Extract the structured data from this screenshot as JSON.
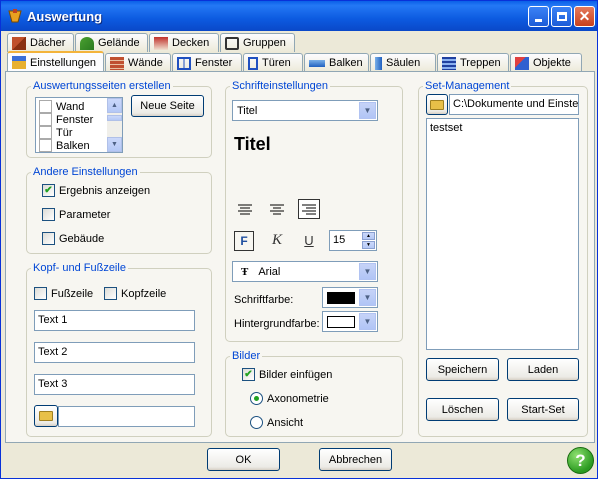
{
  "window": {
    "title": "Auswertung"
  },
  "tabs_row1": [
    "Dächer",
    "Gelände",
    "Decken",
    "Gruppen"
  ],
  "tabs_row2": [
    "Einstellungen",
    "Wände",
    "Fenster",
    "Türen",
    "Balken",
    "Säulen",
    "Treppen",
    "Objekte"
  ],
  "auswertungsseiten": {
    "legend": "Auswertungsseiten erstellen",
    "items": [
      "Wand",
      "Fenster",
      "Tür",
      "Balken"
    ],
    "new_page_button": "Neue Seite"
  },
  "andere": {
    "legend": "Andere Einstellungen",
    "ergebnis": "Ergebnis anzeigen",
    "parameter": "Parameter",
    "gebaeude": "Gebäude"
  },
  "kopf": {
    "legend": "Kopf- und Fußzeile",
    "fusszeile": "Fußzeile",
    "kopfzeile": "Kopfzeile",
    "text1": "Text 1",
    "text2": "Text 2",
    "text3": "Text 3",
    "path": ""
  },
  "schrift": {
    "legend": "Schrifteinstellungen",
    "style_selected": "Titel",
    "preview": "Titel",
    "size": "15",
    "font": "Arial",
    "schriftfarbe_label": "Schriftfarbe:",
    "hintergrund_label": "Hintergrundfarbe:",
    "text_color": "#000000",
    "bg_color": "#ffffff"
  },
  "bilder": {
    "legend": "Bilder",
    "einfuegen": "Bilder einfügen",
    "axonometrie": "Axonometrie",
    "ansicht": "Ansicht"
  },
  "set": {
    "legend": "Set-Management",
    "path": "C:\\Dokumente und Einste",
    "items": [
      "testset"
    ],
    "speichern": "Speichern",
    "laden": "Laden",
    "loeschen": "Löschen",
    "startset": "Start-Set"
  },
  "footer": {
    "ok": "OK",
    "abbrechen": "Abbrechen"
  }
}
